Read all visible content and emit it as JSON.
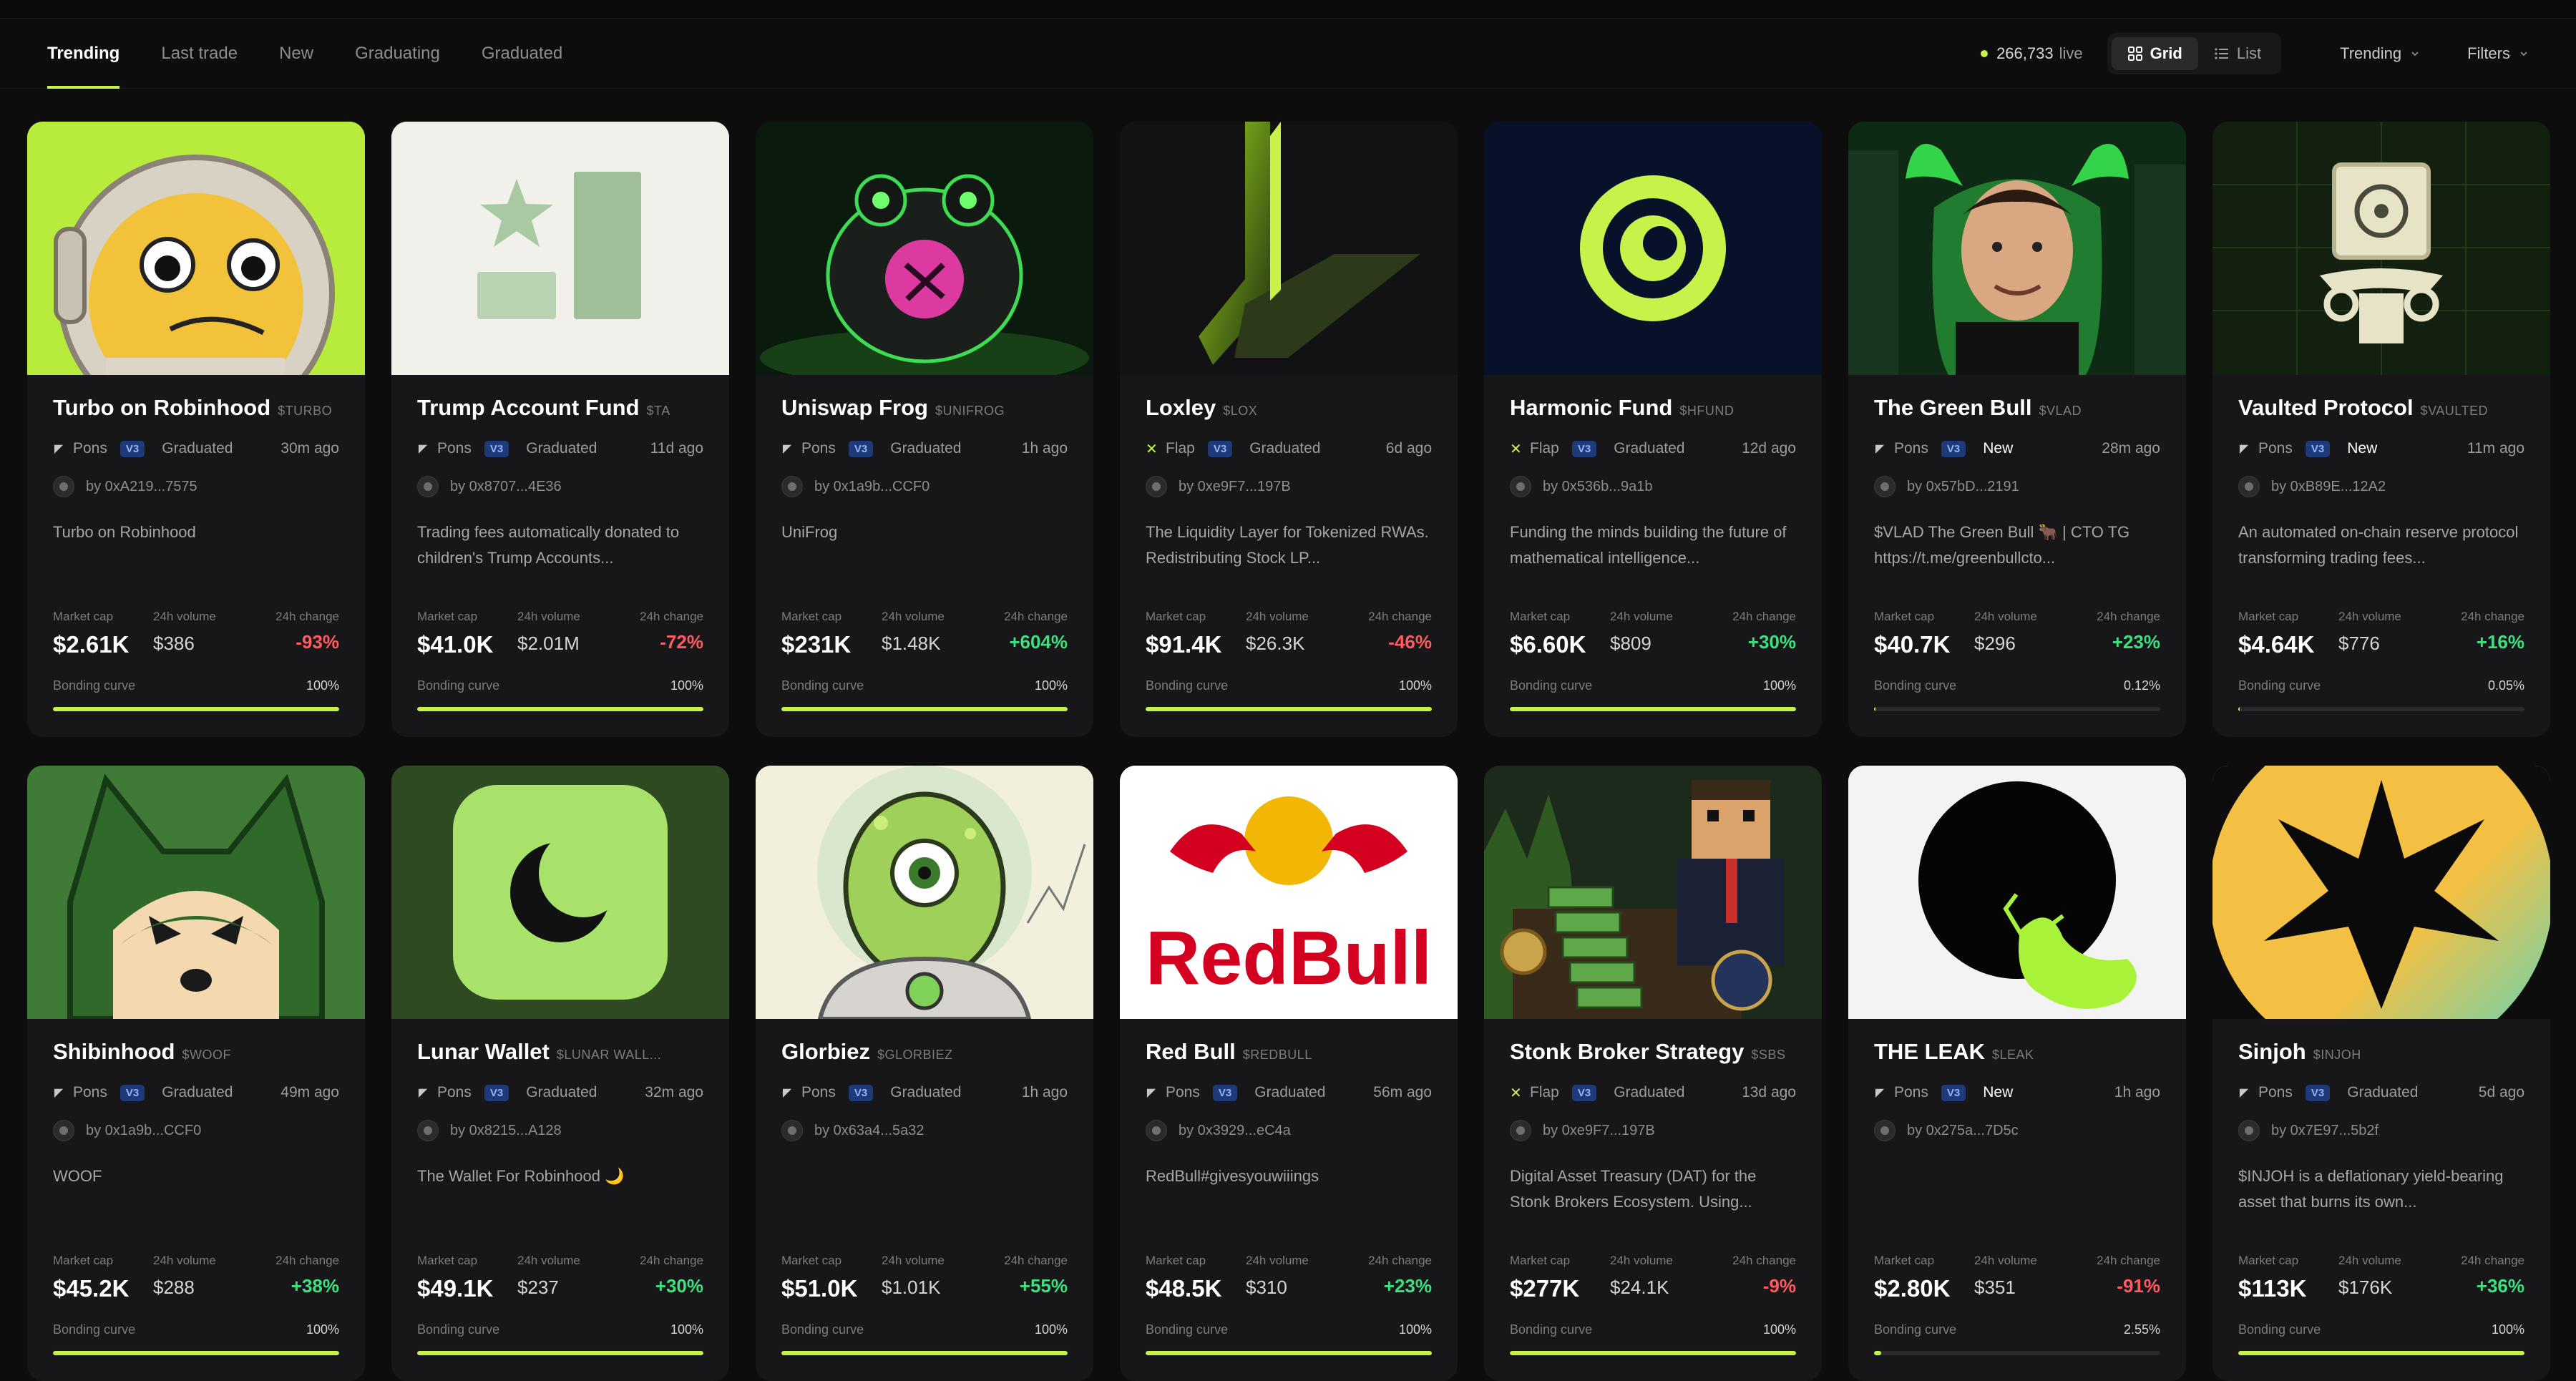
{
  "tabs": [
    "Trending",
    "Last trade",
    "New",
    "Graduating",
    "Graduated"
  ],
  "live": {
    "count": "266,733",
    "label": "live"
  },
  "view": {
    "grid": "Grid",
    "list": "List"
  },
  "sort_label": "Trending",
  "filters_label": "Filters",
  "labels": {
    "market_cap": "Market cap",
    "volume": "24h volume",
    "change": "24h change",
    "bonding": "Bonding curve"
  },
  "colors": {
    "accent": "#c6f24a",
    "up": "#3ee07e",
    "down": "#ff5a5f",
    "badge": "#1e3a78"
  },
  "cards": [
    {
      "name": "Turbo on Robinhood",
      "ticker": "$TURBO",
      "platform": "Pons",
      "platform_icon": "pons-icon",
      "version": "V3",
      "status": "Graduated",
      "age": "30m ago",
      "creator": "by 0xA219...7575",
      "description": "Turbo on Robinhood",
      "market_cap": "$2.61K",
      "volume": "$386",
      "change": "-93%",
      "direction": "down",
      "bonding": "100%",
      "bonding_fraction": 1.0
    },
    {
      "name": "Trump Account Fund",
      "ticker": "$TA",
      "platform": "Pons",
      "platform_icon": "pons-icon",
      "version": "V3",
      "status": "Graduated",
      "age": "11d ago",
      "creator": "by 0x8707...4E36",
      "description": "Trading fees automatically donated to children's Trump Accounts...",
      "market_cap": "$41.0K",
      "volume": "$2.01M",
      "change": "-72%",
      "direction": "down",
      "bonding": "100%",
      "bonding_fraction": 1.0
    },
    {
      "name": "Uniswap Frog",
      "ticker": "$UNIFROG",
      "platform": "Pons",
      "platform_icon": "pons-icon",
      "version": "V3",
      "status": "Graduated",
      "age": "1h ago",
      "creator": "by 0x1a9b...CCF0",
      "description": "UniFrog",
      "market_cap": "$231K",
      "volume": "$1.48K",
      "change": "+604%",
      "direction": "up",
      "bonding": "100%",
      "bonding_fraction": 1.0
    },
    {
      "name": "Loxley",
      "ticker": "$LOX",
      "platform": "Flap",
      "platform_icon": "flap-icon",
      "version": "V3",
      "status": "Graduated",
      "age": "6d ago",
      "creator": "by 0xe9F7...197B",
      "description": "The Liquidity Layer for Tokenized RWAs. Redistributing Stock LP...",
      "market_cap": "$91.4K",
      "volume": "$26.3K",
      "change": "-46%",
      "direction": "down",
      "bonding": "100%",
      "bonding_fraction": 1.0
    },
    {
      "name": "Harmonic Fund",
      "ticker": "$HFUND",
      "platform": "Flap",
      "platform_icon": "flap-icon",
      "version": "V3",
      "status": "Graduated",
      "age": "12d ago",
      "creator": "by 0x536b...9a1b",
      "description": "Funding the minds building the future of mathematical intelligence...",
      "market_cap": "$6.60K",
      "volume": "$809",
      "change": "+30%",
      "direction": "up",
      "bonding": "100%",
      "bonding_fraction": 1.0
    },
    {
      "name": "The Green Bull",
      "ticker": "$VLAD",
      "platform": "Pons",
      "platform_icon": "pons-icon",
      "version": "V3",
      "status": "New",
      "age": "28m ago",
      "creator": "by 0x57bD...2191",
      "description": "$VLAD The Green Bull 🐂 | CTO TG https://t.me/greenbullcto...",
      "market_cap": "$40.7K",
      "volume": "$296",
      "change": "+23%",
      "direction": "up",
      "bonding": "0.12%",
      "bonding_fraction": 0.0012
    },
    {
      "name": "Vaulted Protocol",
      "ticker": "$VAULTED",
      "platform": "Pons",
      "platform_icon": "pons-icon",
      "version": "V3",
      "status": "New",
      "age": "11m ago",
      "creator": "by 0xB89E...12A2",
      "description": "An automated on-chain reserve protocol transforming trading fees...",
      "market_cap": "$4.64K",
      "volume": "$776",
      "change": "+16%",
      "direction": "up",
      "bonding": "0.05%",
      "bonding_fraction": 0.0005
    },
    {
      "name": "Shibinhood",
      "ticker": "$WOOF",
      "platform": "Pons",
      "platform_icon": "pons-icon",
      "version": "V3",
      "status": "Graduated",
      "age": "49m ago",
      "creator": "by 0x1a9b...CCF0",
      "description": "WOOF",
      "market_cap": "$45.2K",
      "volume": "$288",
      "change": "+38%",
      "direction": "up",
      "bonding": "100%",
      "bonding_fraction": 1.0
    },
    {
      "name": "Lunar Wallet",
      "ticker": "$LUNAR WALL...",
      "platform": "Pons",
      "platform_icon": "pons-icon",
      "version": "V3",
      "status": "Graduated",
      "age": "32m ago",
      "creator": "by 0x8215...A128",
      "description": "The Wallet For Robinhood 🌙",
      "market_cap": "$49.1K",
      "volume": "$237",
      "change": "+30%",
      "direction": "up",
      "bonding": "100%",
      "bonding_fraction": 1.0
    },
    {
      "name": "Glorbiez",
      "ticker": "$GLORBIEZ",
      "platform": "Pons",
      "platform_icon": "pons-icon",
      "version": "V3",
      "status": "Graduated",
      "age": "1h ago",
      "creator": "by 0x63a4...5a32",
      "description": "",
      "market_cap": "$51.0K",
      "volume": "$1.01K",
      "change": "+55%",
      "direction": "up",
      "bonding": "100%",
      "bonding_fraction": 1.0
    },
    {
      "name": "Red Bull",
      "ticker": "$REDBULL",
      "platform": "Pons",
      "platform_icon": "pons-icon",
      "version": "V3",
      "status": "Graduated",
      "age": "56m ago",
      "creator": "by 0x3929...eC4a",
      "description": "RedBull#givesyouwiiings",
      "market_cap": "$48.5K",
      "volume": "$310",
      "change": "+23%",
      "direction": "up",
      "bonding": "100%",
      "bonding_fraction": 1.0
    },
    {
      "name": "Stonk Broker Strategy",
      "ticker": "$SBS",
      "platform": "Flap",
      "platform_icon": "flap-icon",
      "version": "V3",
      "status": "Graduated",
      "age": "13d ago",
      "creator": "by 0xe9F7...197B",
      "description": "Digital Asset Treasury (DAT) for the Stonk Brokers Ecosystem. Using...",
      "market_cap": "$277K",
      "volume": "$24.1K",
      "change": "-9%",
      "direction": "down",
      "bonding": "100%",
      "bonding_fraction": 1.0
    },
    {
      "name": "THE LEAK",
      "ticker": "$LEAK",
      "platform": "Pons",
      "platform_icon": "pons-icon",
      "version": "V3",
      "status": "New",
      "age": "1h ago",
      "creator": "by 0x275a...7D5c",
      "description": "",
      "market_cap": "$2.80K",
      "volume": "$351",
      "change": "-91%",
      "direction": "down",
      "bonding": "2.55%",
      "bonding_fraction": 0.0255
    },
    {
      "name": "Sinjoh",
      "ticker": "$INJOH",
      "platform": "Pons",
      "platform_icon": "pons-icon",
      "version": "V3",
      "status": "Graduated",
      "age": "5d ago",
      "creator": "by 0x7E97...5b2f",
      "description": "$INJOH is a deflationary yield-bearing asset that burns its own...",
      "market_cap": "$113K",
      "volume": "$176K",
      "change": "+36%",
      "direction": "up",
      "bonding": "100%",
      "bonding_fraction": 1.0
    }
  ],
  "thumb_images": [
    {
      "caption": "",
      "icon": "turbo-duck-astronaut-image",
      "bg": "#b8ec3c"
    },
    {
      "caption": "",
      "icon": "star-bars-logo-image",
      "bg": "#f1f0ea"
    },
    {
      "caption": "",
      "icon": "neon-frog-image",
      "bg": "#0a1a0c"
    },
    {
      "caption": "",
      "icon": "loxley-l-logo-image",
      "bg": "#121214"
    },
    {
      "caption": "",
      "icon": "harmonic-ring-logo-image",
      "bg": "#07122a"
    },
    {
      "caption": "",
      "icon": "green-bull-man-image",
      "bg": "#123318"
    },
    {
      "caption": "",
      "icon": "vault-emblem-image",
      "bg": "#13200f"
    },
    {
      "caption": "",
      "icon": "hooded-shiba-image",
      "bg": "#3f7a36"
    },
    {
      "caption": "",
      "icon": "moon-app-icon-image",
      "bg": "#2e4a23"
    },
    {
      "caption": "",
      "icon": "alien-astronaut-image",
      "bg": "#f2efdd"
    },
    {
      "caption": "",
      "icon": "red-bull-logo-image",
      "bg": "#ffffff"
    },
    {
      "caption": "",
      "icon": "pixel-broker-image",
      "bg": "#1b2a1a"
    },
    {
      "caption": "",
      "icon": "black-hole-leak-image",
      "bg": "#f3f3f3"
    },
    {
      "caption": "",
      "icon": "sinjoh-star-image",
      "bg": "#f4c043"
    }
  ]
}
